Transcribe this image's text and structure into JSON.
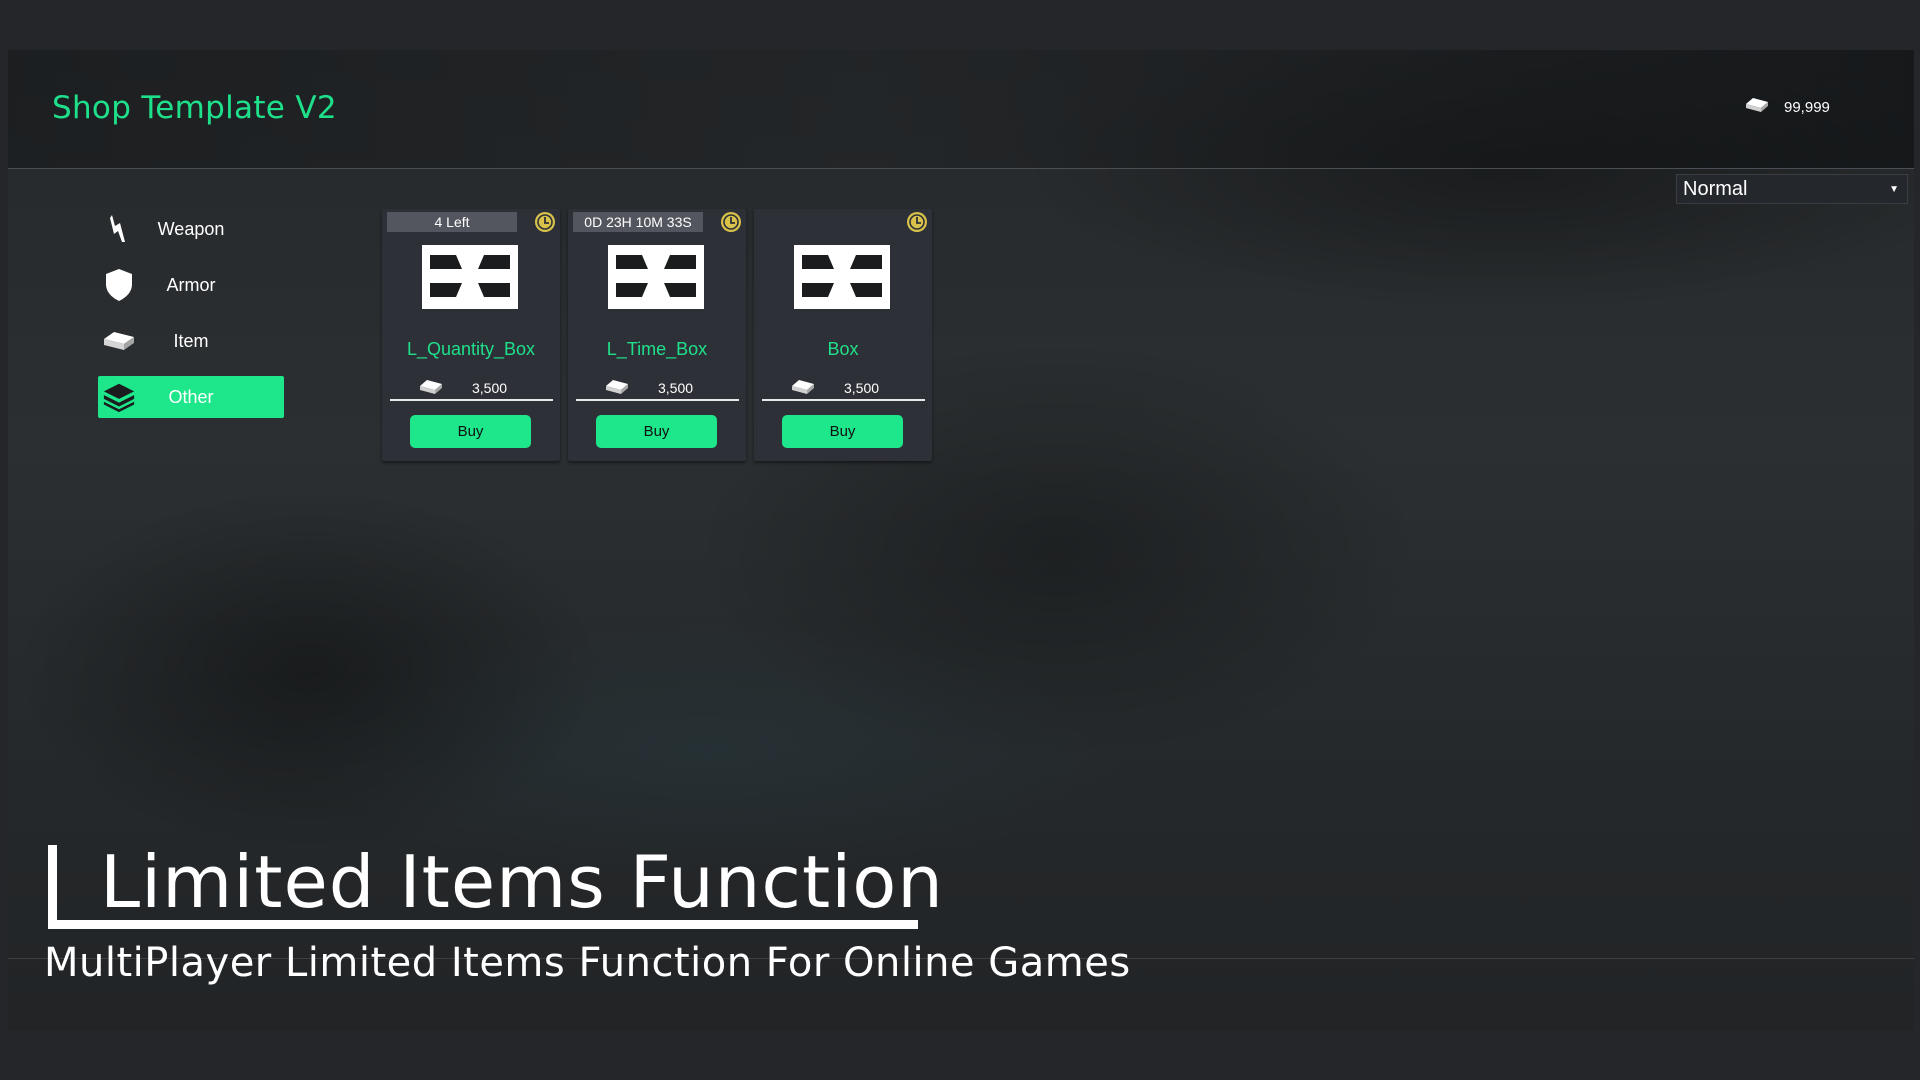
{
  "header": {
    "title": "Shop Template V2",
    "currency_icon": "silver-ingot-icon",
    "currency_amount": "99,999"
  },
  "filter": {
    "selected": "Normal"
  },
  "sidebar": {
    "items": [
      {
        "label": "Weapon",
        "icon": "weapon-icon",
        "active": false
      },
      {
        "label": "Armor",
        "icon": "shield-icon",
        "active": false
      },
      {
        "label": "Item",
        "icon": "ingot-icon",
        "active": false
      },
      {
        "label": "Other",
        "icon": "layers-icon",
        "active": true
      }
    ]
  },
  "cards": [
    {
      "limit_text": "4 Left",
      "name": "L_Quantity_Box",
      "price": "3,500",
      "buy_label": "Buy"
    },
    {
      "limit_text": "0D 23H 10M 33S",
      "name": "L_Time_Box",
      "price": "3,500",
      "buy_label": "Buy"
    },
    {
      "limit_text": "",
      "name": "Box",
      "price": "3,500",
      "buy_label": "Buy"
    }
  ],
  "colors": {
    "accent": "#1ee68a",
    "background": "#252629",
    "card": "#2e3038",
    "clock_badge": "#d8c24a"
  },
  "caption": {
    "title": "Limited Items Function",
    "subtitle": "MultiPlayer Limited Items Function For Online Games"
  }
}
